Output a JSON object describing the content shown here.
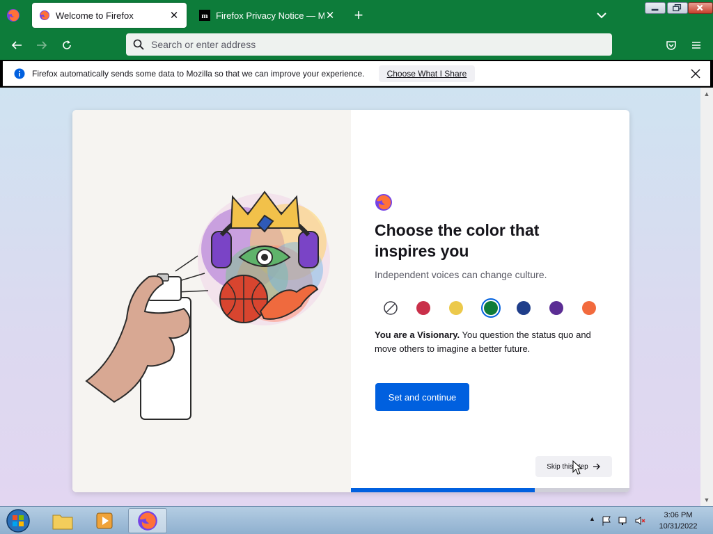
{
  "tabs": [
    {
      "title": "Welcome to Firefox",
      "active": true,
      "favicon": "firefox-icon"
    },
    {
      "title": "Firefox Privacy Notice — Mozilla",
      "active": false,
      "favicon": "mozilla-m-icon"
    }
  ],
  "url_bar": {
    "placeholder": "Search or enter address"
  },
  "notification": {
    "message": "Firefox automatically sends some data to Mozilla so that we can improve your experience.",
    "button_label": "Choose What I Share"
  },
  "onboarding": {
    "title": "Choose the color that inspires you",
    "subtitle": "Independent voices can change culture.",
    "description_bold": "You are a Visionary.",
    "description_rest": " You question the status quo and move others to imagine a better future.",
    "primary_button": "Set and continue",
    "skip_button": "Skip this step",
    "progress": 0.66,
    "swatches": [
      {
        "name": "none",
        "color": "#ffffff",
        "selected": false
      },
      {
        "name": "red",
        "color": "#c9304a",
        "selected": false
      },
      {
        "name": "yellow",
        "color": "#ecc94b",
        "selected": false
      },
      {
        "name": "green",
        "color": "#0f7c3a",
        "selected": true
      },
      {
        "name": "blue",
        "color": "#1f3e8a",
        "selected": false
      },
      {
        "name": "purple",
        "color": "#5b2d94",
        "selected": false
      },
      {
        "name": "orange",
        "color": "#f26a3d",
        "selected": false
      }
    ]
  },
  "colors": {
    "theme": "#0d7c3a",
    "accent": "#0060df"
  },
  "taskbar": {
    "time": "3:06 PM",
    "date": "10/31/2022"
  }
}
